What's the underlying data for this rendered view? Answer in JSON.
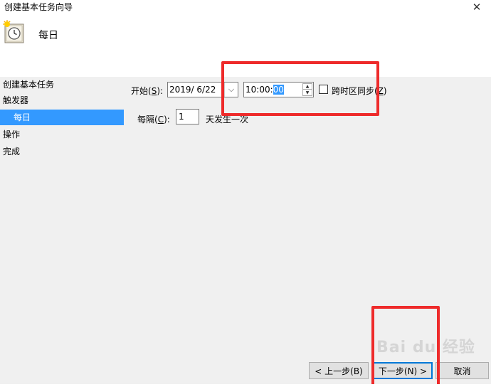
{
  "window": {
    "title": "创建基本任务向导"
  },
  "header": {
    "title": "每日"
  },
  "sidebar": {
    "items": [
      {
        "label": "创建基本任务"
      },
      {
        "label": "触发器"
      },
      {
        "label": "每日"
      },
      {
        "label": "操作"
      },
      {
        "label": "完成"
      }
    ]
  },
  "form": {
    "start_label": "开始(",
    "start_key": "S",
    "start_suffix": "):",
    "date_value": "2019/  6/22",
    "time_prefix": "10:00:",
    "time_selected": "00",
    "sync_label": "跨时区同步(",
    "sync_key": "Z",
    "sync_suffix": ")",
    "interval_label": "每隔(",
    "interval_key": "C",
    "interval_suffix": "):",
    "interval_value": "1",
    "interval_unit": "天发生一次"
  },
  "buttons": {
    "back": "< 上一步(B)",
    "next": "下一步(N) >",
    "cancel": "取消"
  },
  "watermark": "Bai du 经验",
  "colors": {
    "selection": "#3399ff",
    "highlight": "#ee2b2b"
  }
}
